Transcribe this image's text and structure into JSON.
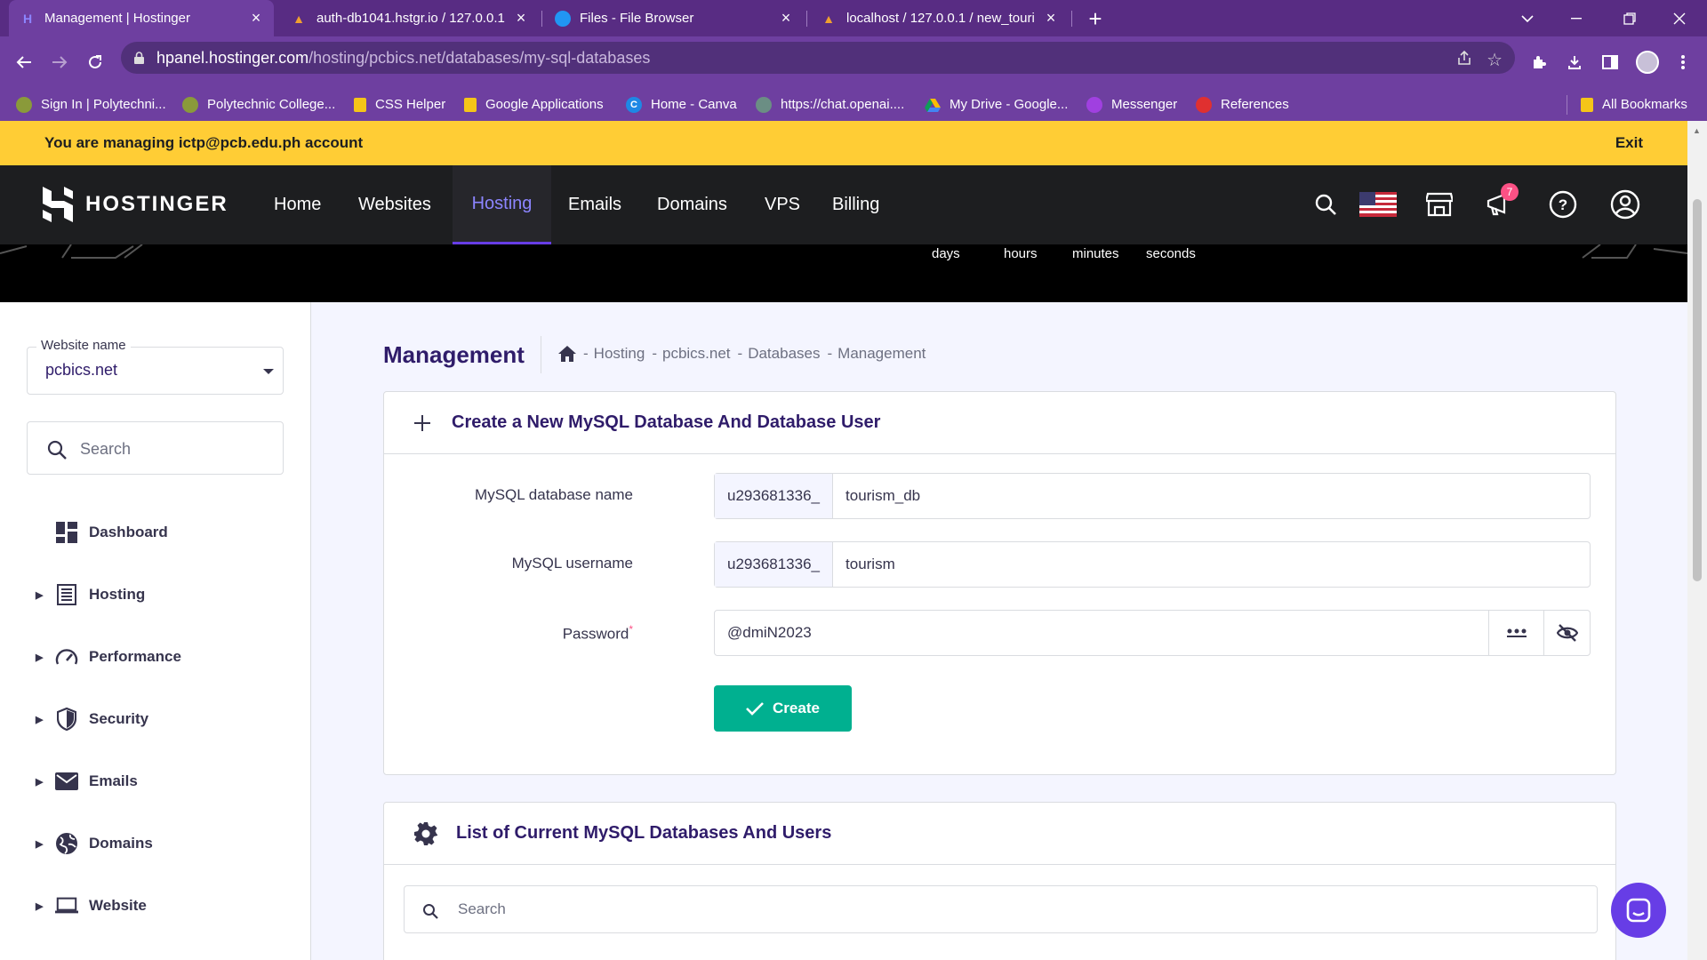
{
  "browser": {
    "tabs": [
      {
        "title": "Management | Hostinger"
      },
      {
        "title": "auth-db1041.hstgr.io / 127.0.0.1"
      },
      {
        "title": "Files - File Browser"
      },
      {
        "title": "localhost / 127.0.0.1 / new_touri"
      }
    ],
    "url_host": "hpanel.hostinger.com",
    "url_path": "/hosting/pcbics.net/databases/my-sql-databases",
    "bookmarks": [
      {
        "label": "Sign In | Polytechni..."
      },
      {
        "label": "Polytechnic College..."
      },
      {
        "label": "CSS Helper"
      },
      {
        "label": "Google Applications"
      },
      {
        "label": "Home - Canva"
      },
      {
        "label": "https://chat.openai...."
      },
      {
        "label": "My Drive - Google..."
      },
      {
        "label": "Messenger"
      },
      {
        "label": "References"
      }
    ],
    "all_bookmarks": "All Bookmarks"
  },
  "banner": {
    "text": "You are managing ictp@pcb.edu.ph account",
    "exit": "Exit"
  },
  "nav": {
    "brand": "HOSTINGER",
    "links": [
      "Home",
      "Websites",
      "Hosting",
      "Emails",
      "Domains",
      "VPS",
      "Billing"
    ],
    "active": "Hosting",
    "notification_count": "7"
  },
  "countdown": {
    "labels": [
      "days",
      "hours",
      "minutes",
      "seconds"
    ]
  },
  "sidebar": {
    "website_label": "Website name",
    "website_value": "pcbics.net",
    "search_placeholder": "Search",
    "items": [
      {
        "label": "Dashboard",
        "icon": "dashboard-icon"
      },
      {
        "label": "Hosting",
        "icon": "hosting-icon"
      },
      {
        "label": "Performance",
        "icon": "performance-icon"
      },
      {
        "label": "Security",
        "icon": "shield-icon"
      },
      {
        "label": "Emails",
        "icon": "mail-icon"
      },
      {
        "label": "Domains",
        "icon": "globe-icon"
      },
      {
        "label": "Website",
        "icon": "laptop-icon"
      }
    ]
  },
  "main": {
    "page_title": "Management",
    "breadcrumb": [
      "Hosting",
      "pcbics.net",
      "Databases",
      "Management"
    ],
    "create_card": {
      "title": "Create a New MySQL Database And Database User",
      "db_name_label": "MySQL database name",
      "db_prefix": "u293681336_",
      "db_name_value": "tourism_db",
      "username_label": "MySQL username",
      "user_prefix": "u293681336_",
      "username_value": "tourism",
      "password_label": "Password",
      "password_required": "*",
      "password_value": "@dmiN2023",
      "create_button": "Create"
    },
    "list_card": {
      "title": "List of Current MySQL Databases And Users",
      "search_placeholder": "Search"
    }
  },
  "colors": {
    "browser_frame": "#582c83",
    "banner": "#ffcd35",
    "nav_bg": "#1d1e20",
    "accent": "#673de6",
    "create_button": "#00b090"
  }
}
